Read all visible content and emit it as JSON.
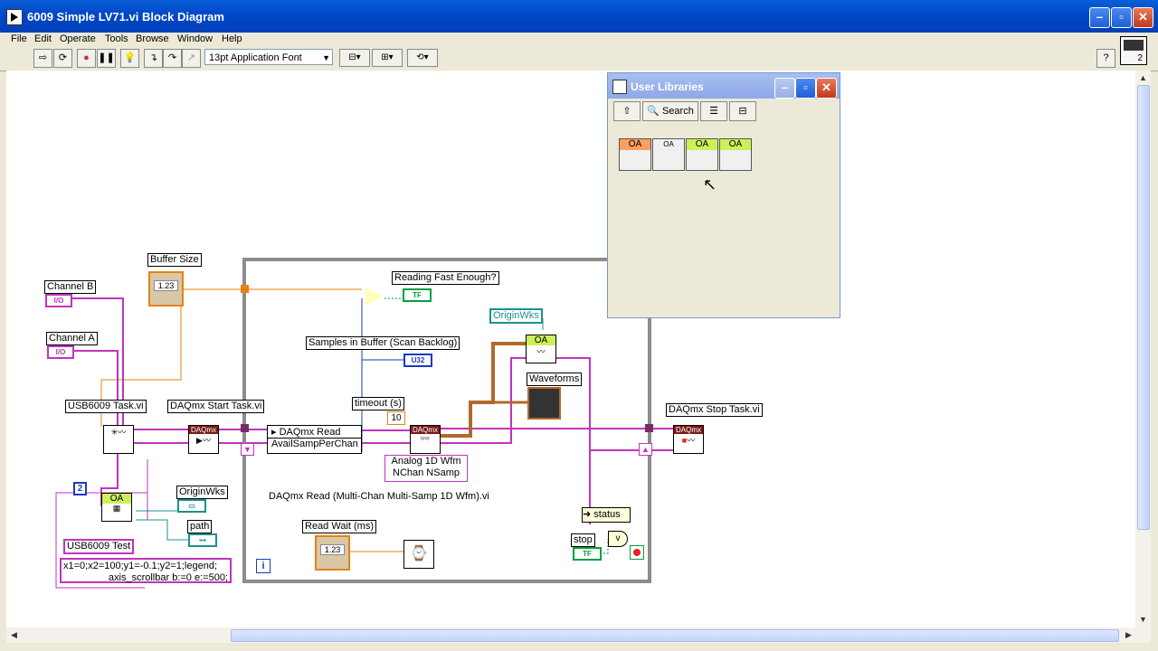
{
  "window": {
    "title": "6009 Simple LV71.vi Block Diagram"
  },
  "menu": [
    "File",
    "Edit",
    "Operate",
    "Tools",
    "Browse",
    "Window",
    "Help"
  ],
  "toolbar": {
    "font": "13pt Application Font",
    "help_label": "?",
    "context_num": "2"
  },
  "palette": {
    "title": "User Libraries",
    "search_label": "Search",
    "icons": [
      {
        "hd": "OA",
        "name": "oa-icon-1"
      },
      {
        "hd": "OA",
        "name": "oa-icon-2"
      },
      {
        "hd": "OA",
        "name": "oa-icon-3"
      },
      {
        "hd": "OA",
        "name": "oa-icon-4"
      }
    ]
  },
  "diagram": {
    "buffer_size": "Buffer Size",
    "channel_b": "Channel B",
    "channel_a": "Channel A",
    "io": "I/O",
    "dbl": "1.23",
    "usb_task": "USB6009 Task.vi",
    "start_task": "DAQmx Start Task.vi",
    "daqmx_read": "DAQmx Read",
    "avail_samp": "AvailSampPerChan",
    "reading_fast": "Reading Fast Enough?",
    "tf": "TF",
    "samples_in_buffer": "Samples in Buffer (Scan Backlog)",
    "u32": "U32",
    "timeout": "timeout (s)",
    "timeout_val": "10",
    "originwks": "OriginWks",
    "oa": "OA",
    "waveforms": "Waveforms",
    "analog_wfm_1": "Analog 1D Wfm",
    "analog_wfm_2": "NChan NSamp",
    "daqmx_read_vi": "DAQmx Read (Multi-Chan Multi-Samp 1D Wfm).vi",
    "read_wait": "Read Wait (ms)",
    "stop_task": "DAQmx Stop Task.vi",
    "daqmx_small": "DAQmx",
    "status": "status",
    "stop": "stop",
    "const_2": "2",
    "originwks2": "OriginWks",
    "path": "path",
    "usb_test": "USB6009 Test",
    "script_1": "x1=0;x2=100;y1=-0.1;y2=1;legend;",
    "script_2": "axis_scrollbar b:=0 e:=500;",
    "loop_i": "i"
  }
}
